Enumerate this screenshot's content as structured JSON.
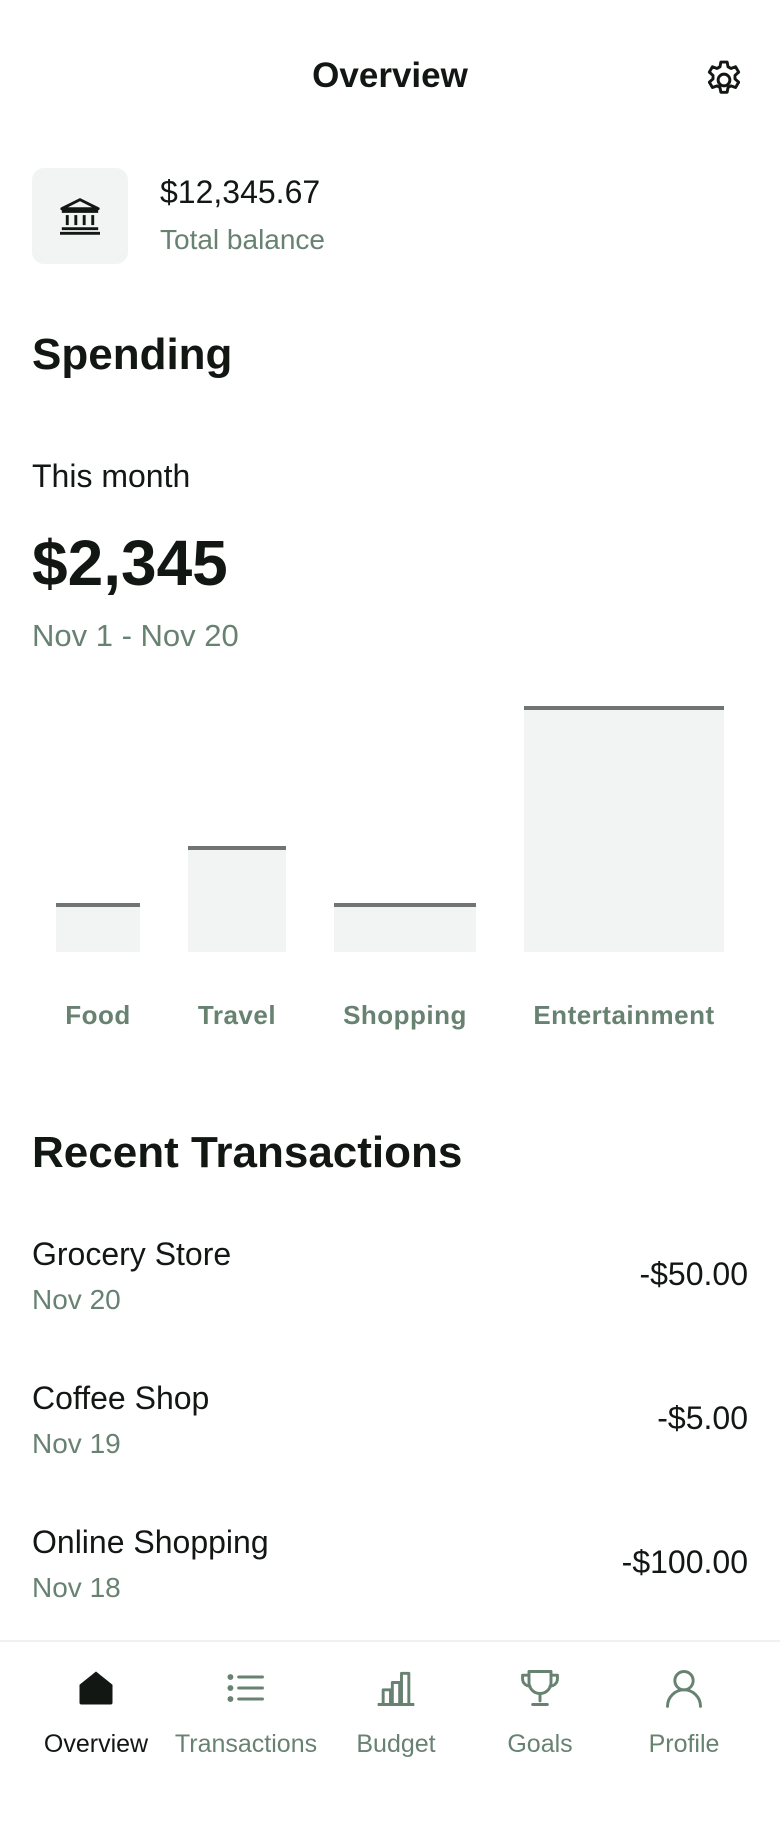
{
  "header": {
    "title": "Overview",
    "settings_icon": "gear-icon"
  },
  "balance": {
    "icon": "bank-icon",
    "amount": "$12,345.67",
    "label": "Total balance"
  },
  "spending": {
    "title": "Spending",
    "period_label": "This month",
    "total": "$2,345",
    "date_range": "Nov 1 - Nov 20"
  },
  "chart_data": {
    "type": "bar",
    "categories": [
      "Food",
      "Travel",
      "Shopping",
      "Entertainment"
    ],
    "values": [
      0.2,
      0.43,
      0.2,
      1.0
    ],
    "title": "",
    "xlabel": "",
    "ylabel": "",
    "ylim": [
      0,
      1
    ],
    "grid": false,
    "bar_color": "#f1f4f2",
    "bar_top_color": "#6f7570"
  },
  "recent": {
    "title": "Recent Transactions",
    "items": [
      {
        "name": "Grocery Store",
        "date": "Nov 20",
        "amount": "-$50.00"
      },
      {
        "name": "Coffee Shop",
        "date": "Nov 19",
        "amount": "-$5.00"
      },
      {
        "name": "Online Shopping",
        "date": "Nov 18",
        "amount": "-$100.00"
      }
    ]
  },
  "nav": {
    "items": [
      {
        "label": "Overview",
        "icon": "home-icon",
        "active": true
      },
      {
        "label": "Transactions",
        "icon": "list-icon",
        "active": false
      },
      {
        "label": "Budget",
        "icon": "bar-chart-icon",
        "active": false
      },
      {
        "label": "Goals",
        "icon": "trophy-icon",
        "active": false
      },
      {
        "label": "Profile",
        "icon": "user-icon",
        "active": false
      }
    ]
  },
  "colors": {
    "primary_text": "#121714",
    "secondary_text": "#688272",
    "surface": "#f1f4f2"
  }
}
